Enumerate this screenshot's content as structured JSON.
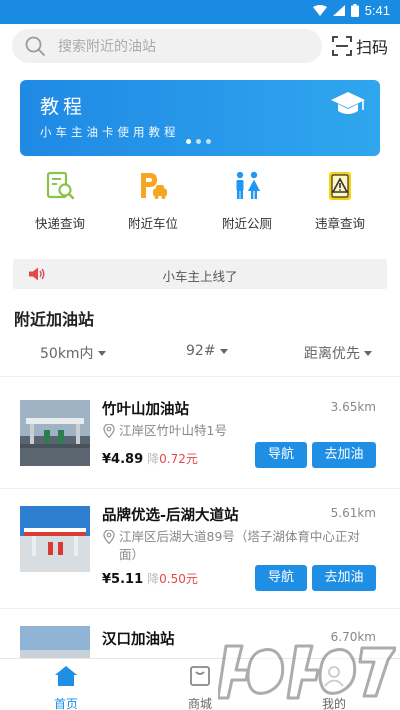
{
  "status_bar": {
    "time": "5:41"
  },
  "search": {
    "placeholder": "搜索附近的油站",
    "scan_label": "扫码"
  },
  "banner": {
    "title": "教程",
    "subtitle": "小车主油卡使用教程",
    "page_count": 3,
    "active_page": 1
  },
  "quick_actions": [
    {
      "label": "快递查询",
      "icon": "package-search-icon",
      "color": "#8bc34a"
    },
    {
      "label": "附近车位",
      "icon": "parking-icon",
      "color": "#f5a623"
    },
    {
      "label": "附近公厕",
      "icon": "restroom-icon",
      "color": "#2196f3"
    },
    {
      "label": "违章查询",
      "icon": "violation-warning-icon",
      "color": "#f8d210"
    }
  ],
  "notice": {
    "text": "小车主上线了"
  },
  "section": {
    "title": "附近加油站"
  },
  "filters": {
    "range": "50km内",
    "fuel": "92#",
    "sort": "距离优先"
  },
  "stations": [
    {
      "name": "竹叶山加油站",
      "distance": "3.65km",
      "address": "江岸区竹叶山特1号",
      "price": "¥4.89",
      "discount_prefix": "降",
      "discount": "0.72",
      "discount_unit": "元",
      "nav_label": "导航",
      "go_label": "去加油"
    },
    {
      "name": "品牌优选-后湖大道站",
      "distance": "5.61km",
      "address": "江岸区后湖大道89号（塔子湖体育中心正对面）",
      "price": "¥5.11",
      "discount_prefix": "降",
      "discount": "0.50",
      "discount_unit": "元",
      "nav_label": "导航",
      "go_label": "去加油"
    },
    {
      "name": "汉口加油站",
      "distance": "6.70km"
    }
  ],
  "tabs": [
    {
      "label": "首页",
      "icon": "home-icon",
      "active": true
    },
    {
      "label": "商城",
      "icon": "shopping-bag-icon",
      "active": false
    },
    {
      "label": "我的",
      "icon": "user-icon",
      "active": false
    }
  ],
  "colors": {
    "primary": "#1f8fe6",
    "status_bar": "#1a8be3",
    "discount_red": "#e24a4a"
  },
  "watermark": {
    "text": "4O4O7"
  }
}
